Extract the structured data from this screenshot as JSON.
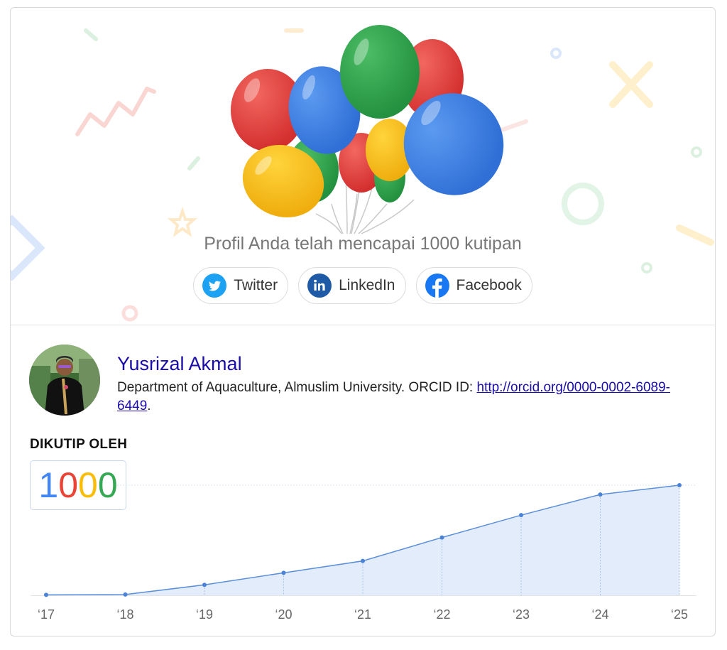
{
  "milestone": {
    "text": "Profil Anda telah mencapai 1000 kutipan"
  },
  "share": [
    {
      "label": "Twitter",
      "icon": "twitter-icon",
      "color": "#1da1f2"
    },
    {
      "label": "LinkedIn",
      "icon": "linkedin-icon",
      "color": "#0a66c2"
    },
    {
      "label": "Facebook",
      "icon": "facebook-icon",
      "color": "#1877f2"
    }
  ],
  "profile": {
    "name": "Yusrizal Akmal",
    "affiliation": "Department of Aquaculture, Almuslim University. ORCID ID: ",
    "orcid_link": "http://orcid.org/0000-0002-6089-6449",
    "trailing": "."
  },
  "cited": {
    "heading": "DIKUTIP OLEH",
    "digits": [
      {
        "d": "1",
        "color": "#4285f4"
      },
      {
        "d": "0",
        "color": "#ea4335"
      },
      {
        "d": "0",
        "color": "#fbbc05"
      },
      {
        "d": "0",
        "color": "#34a853"
      }
    ]
  },
  "chart_data": {
    "type": "area",
    "categories": [
      "‘17",
      "‘18",
      "‘19",
      "‘20",
      "‘21",
      "‘22",
      "‘23",
      "‘24",
      "‘25"
    ],
    "values": [
      4,
      7,
      95,
      204,
      312,
      525,
      728,
      915,
      1000
    ],
    "ylim": [
      0,
      1000
    ],
    "grid": false,
    "line_color": "#5b8fd9",
    "fill_color": "#e3ecfa"
  },
  "colors": {
    "balloon_red": "#e53935",
    "balloon_blue": "#3d7ee0",
    "balloon_green": "#34a14f",
    "balloon_yellow": "#f4bd1b"
  }
}
